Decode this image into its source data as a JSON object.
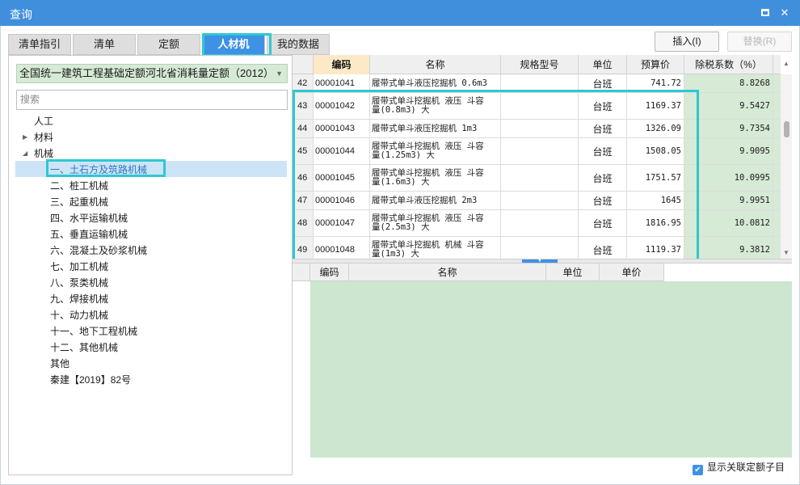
{
  "window": {
    "title": "查询"
  },
  "tabs": [
    {
      "label": "清单指引"
    },
    {
      "label": "清单"
    },
    {
      "label": "定额"
    },
    {
      "label": "人材机"
    },
    {
      "label": "我的数据"
    }
  ],
  "active_tab": "人材机",
  "buttons": {
    "insert": "插入(I)",
    "replace": "替换(R)"
  },
  "left_panel": {
    "library_select": "全国统一建筑工程基础定额河北省消耗量定额（2012）",
    "search_placeholder": "搜索",
    "tree": [
      {
        "label": "人工",
        "level": 0,
        "expander": ""
      },
      {
        "label": "材料",
        "level": 0,
        "expander": "collapsed"
      },
      {
        "label": "机械",
        "level": 0,
        "expander": "expanded"
      },
      {
        "label": "一、土石方及筑路机械",
        "level": 1,
        "selected": true
      },
      {
        "label": "二、桩工机械",
        "level": 1
      },
      {
        "label": "三、起重机械",
        "level": 1
      },
      {
        "label": "四、水平运输机械",
        "level": 1
      },
      {
        "label": "五、垂直运输机械",
        "level": 1
      },
      {
        "label": "六、混凝土及砂浆机械",
        "level": 1
      },
      {
        "label": "七、加工机械",
        "level": 1
      },
      {
        "label": "八、泵类机械",
        "level": 1
      },
      {
        "label": "九、焊接机械",
        "level": 1
      },
      {
        "label": "十、动力机械",
        "level": 1
      },
      {
        "label": "十一、地下工程机械",
        "level": 1
      },
      {
        "label": "十二、其他机械",
        "level": 1
      },
      {
        "label": "其他",
        "level": 1
      },
      {
        "label": "秦建【2019】82号",
        "level": 1
      }
    ]
  },
  "grid": {
    "columns": [
      "编码",
      "名称",
      "规格型号",
      "单位",
      "预算价",
      "除税系数（%）"
    ],
    "sorted_column": "编码",
    "rows": [
      {
        "idx": "42",
        "code": "00001041",
        "name": [
          "履带式单斗液压挖掘机 0.6m3"
        ],
        "spec": "",
        "unit": "台班",
        "price": "741.72",
        "coef": "8.8268"
      },
      {
        "idx": "43",
        "code": "00001042",
        "name": [
          "履带式单斗挖掘机 液压 斗容",
          "量(0.8m3) 大"
        ],
        "spec": "",
        "unit": "台班",
        "price": "1169.37",
        "coef": "9.5427"
      },
      {
        "idx": "44",
        "code": "00001043",
        "name": [
          "履带式单斗液压挖掘机 1m3"
        ],
        "spec": "",
        "unit": "台班",
        "price": "1326.09",
        "coef": "9.7354"
      },
      {
        "idx": "45",
        "code": "00001044",
        "name": [
          "履带式单斗挖掘机 液压 斗容",
          "量(1.25m3) 大"
        ],
        "spec": "",
        "unit": "台班",
        "price": "1508.05",
        "coef": "9.9095"
      },
      {
        "idx": "46",
        "code": "00001045",
        "name": [
          "履带式单斗挖掘机 液压 斗容",
          "量(1.6m3) 大"
        ],
        "spec": "",
        "unit": "台班",
        "price": "1751.57",
        "coef": "10.0995"
      },
      {
        "idx": "47",
        "code": "00001046",
        "name": [
          "履带式单斗液压挖掘机 2m3"
        ],
        "spec": "",
        "unit": "台班",
        "price": "1645",
        "coef": "9.9951"
      },
      {
        "idx": "48",
        "code": "00001047",
        "name": [
          "履带式单斗挖掘机 液压 斗容",
          "量(2.5m3) 大"
        ],
        "spec": "",
        "unit": "台班",
        "price": "1816.95",
        "coef": "10.0812"
      },
      {
        "idx": "49",
        "code": "00001048",
        "name": [
          "履带式单斗挖掘机 机械 斗容",
          "量(1m3) 大"
        ],
        "spec": "",
        "unit": "台班",
        "price": "1119.37",
        "coef": "9.3812"
      }
    ]
  },
  "sub_grid": {
    "columns": [
      "编码",
      "名称",
      "单位",
      "单价"
    ]
  },
  "checkbox": {
    "label": "显示关联定额子目",
    "checked": true
  },
  "colors": {
    "titlebar": "#3f8fdc",
    "accent": "#3d92e6",
    "highlight": "#2ec8d2",
    "green_fill": "#cce6d0"
  }
}
